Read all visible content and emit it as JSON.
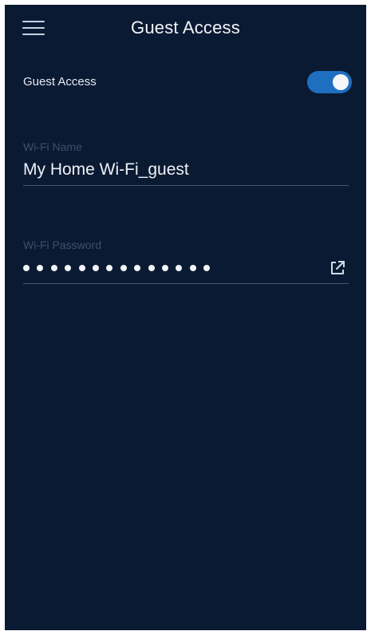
{
  "header": {
    "title": "Guest Access",
    "menu_icon": "hamburger-menu-icon"
  },
  "guest_toggle": {
    "label": "Guest Access",
    "state": "on",
    "on_color": "#1f6fc0"
  },
  "wifi_name": {
    "label": "Wi-Fi Name",
    "value": "My Home Wi-Fi_guest"
  },
  "wifi_password": {
    "label": "Wi-Fi Password",
    "masked_length": 14,
    "share_icon": "share-external-icon"
  },
  "colors": {
    "background": "#0b1a33",
    "accent": "#1f6fc0",
    "divider": "#45546d",
    "muted_label": "#3e4f6a"
  }
}
